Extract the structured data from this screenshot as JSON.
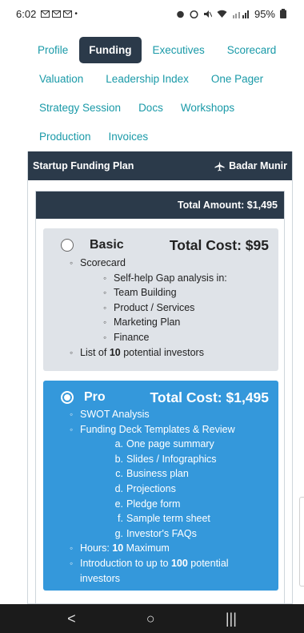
{
  "status": {
    "time": "6:02",
    "left_icons": "⋈⋈⋈ •",
    "battery": "95%"
  },
  "nav": {
    "rows": [
      [
        {
          "label": "Profile",
          "active": false
        },
        {
          "label": "Funding",
          "active": true
        },
        {
          "label": "Executives",
          "active": false
        },
        {
          "label": "Scorecard",
          "active": false
        }
      ],
      [
        {
          "label": "Valuation",
          "active": false
        },
        {
          "label": "Leadership Index",
          "active": false
        },
        {
          "label": "One Pager",
          "active": false
        }
      ],
      [
        {
          "label": "Strategy Session",
          "active": false
        },
        {
          "label": "Docs",
          "active": false
        },
        {
          "label": "Workshops",
          "active": false
        }
      ],
      [
        {
          "label": "Production",
          "active": false
        },
        {
          "label": "Invoices",
          "active": false
        }
      ]
    ]
  },
  "panel": {
    "title": "Startup Funding Plan",
    "user": "Badar Munir",
    "user_icon": "airplane-icon"
  },
  "total": {
    "label": "Total Amount: $1,495"
  },
  "plans": {
    "basic": {
      "name": "Basic",
      "cost": "Total Cost: $95",
      "items": {
        "scorecard": "Scorecard",
        "gap": "Self-help Gap analysis in:",
        "team": "Team Building",
        "product": "Product / Services",
        "marketing": "Marketing Plan",
        "finance": "Finance",
        "investors_pre": "List of ",
        "investors_num": "10",
        "investors_post": " potential investors"
      }
    },
    "pro": {
      "name": "Pro",
      "cost": "Total Cost: $1,495",
      "items": {
        "swot": "SWOT Analysis",
        "deck": "Funding Deck Templates & Review",
        "a_mk": "a.",
        "a": "One page summary",
        "b_mk": "b.",
        "b": "Slides / Infographics",
        "c_mk": "c.",
        "c": "Business plan",
        "d_mk": "d.",
        "d": "Projections",
        "e_mk": "e.",
        "e": "Pledge form",
        "f_mk": "f.",
        "f": "Sample term sheet",
        "g_mk": "g.",
        "g": "Investor's FAQs",
        "hours_pre": "Hours: ",
        "hours_num": "10",
        "hours_post": " Maximum",
        "intro_pre": "Introduction to up to ",
        "intro_num": "100",
        "intro_post": " potential",
        "intro_cont": "investors"
      }
    }
  },
  "sysnav": {
    "back": "<",
    "home": "○",
    "recents": "|||"
  }
}
